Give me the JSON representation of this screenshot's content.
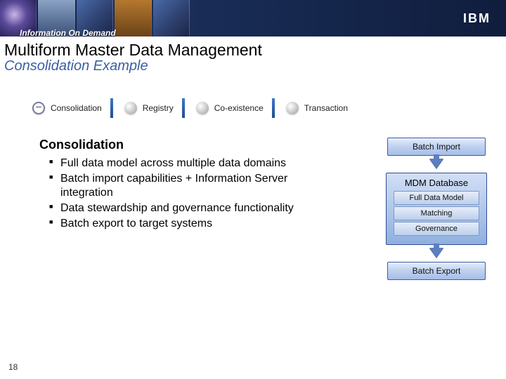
{
  "header": {
    "badge": "Information On Demand",
    "logo": "IBM"
  },
  "title": "Multiform Master Data Management",
  "subtitle": "Consolidation Example",
  "modes": [
    {
      "label": "Consolidation",
      "selected": true
    },
    {
      "label": "Registry",
      "selected": false
    },
    {
      "label": "Co-existence",
      "selected": false
    },
    {
      "label": "Transaction",
      "selected": false
    }
  ],
  "bullets_title": "Consolidation",
  "bullets": [
    "Full data model across multiple data domains",
    "Batch import capabilities + Information Server integration",
    "Data stewardship and governance functionality",
    "Batch export to target systems"
  ],
  "flow": {
    "top": "Batch Import",
    "db_title": "MDM Database",
    "db_items": [
      "Full Data Model",
      "Matching",
      "Governance"
    ],
    "bottom": "Batch Export"
  },
  "page_number": "18"
}
